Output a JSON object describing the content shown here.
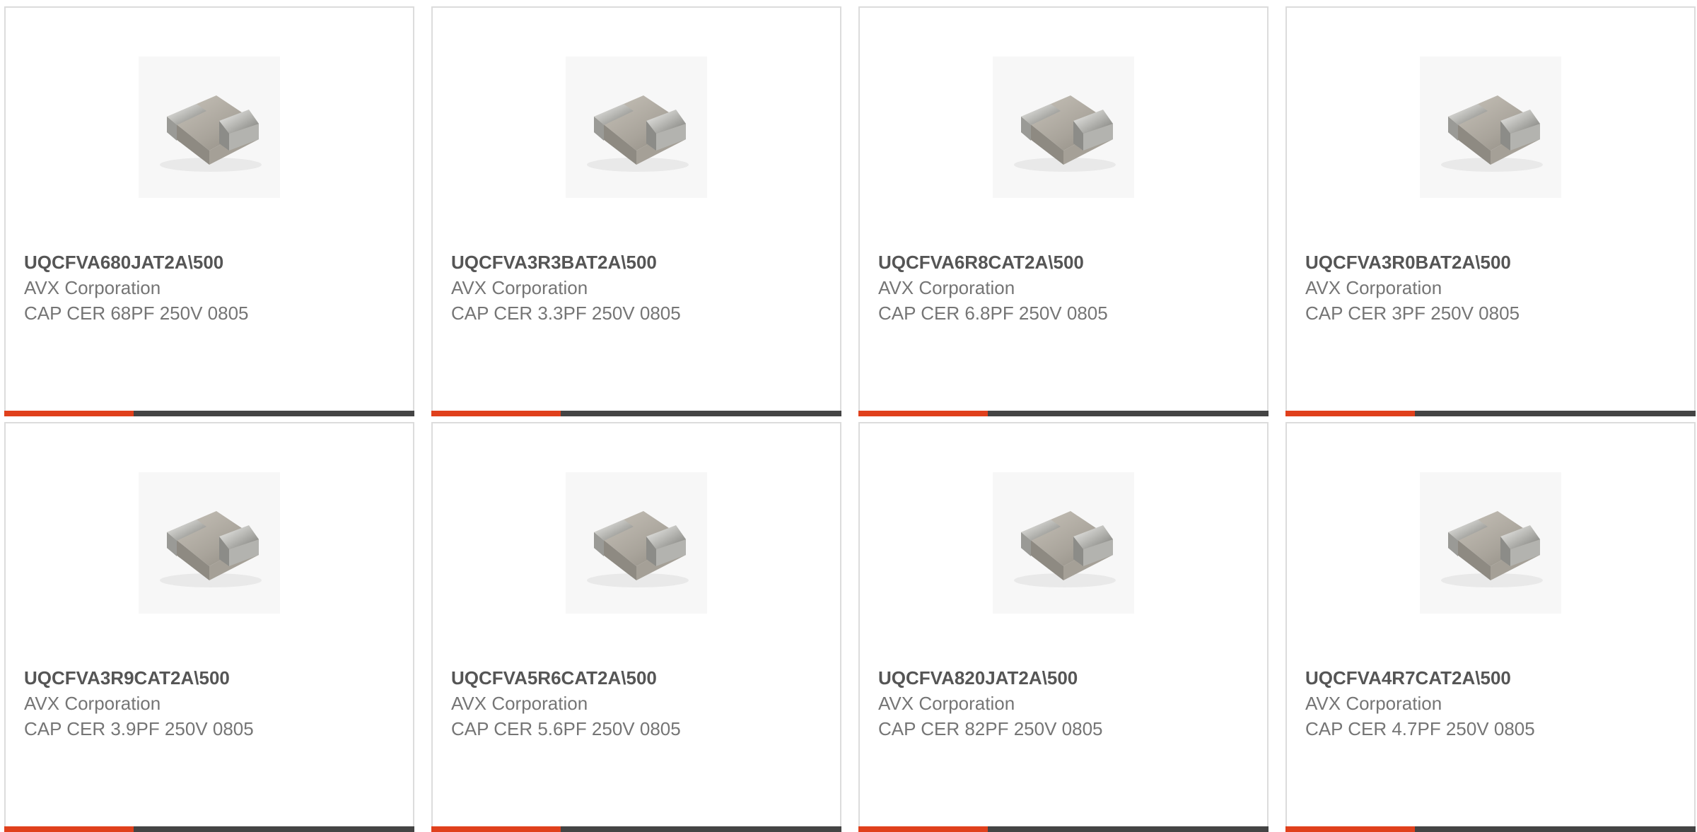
{
  "accent_color": "#e0401c",
  "bar_color": "#444444",
  "products": [
    {
      "part_number": "UQCFVA680JAT2A\\500",
      "manufacturer": "AVX Corporation",
      "description": "CAP CER 68PF 250V 0805",
      "image_icon": "ceramic-capacitor-icon"
    },
    {
      "part_number": "UQCFVA3R3BAT2A\\500",
      "manufacturer": "AVX Corporation",
      "description": "CAP CER 3.3PF 250V 0805",
      "image_icon": "ceramic-capacitor-icon"
    },
    {
      "part_number": "UQCFVA6R8CAT2A\\500",
      "manufacturer": "AVX Corporation",
      "description": "CAP CER 6.8PF 250V 0805",
      "image_icon": "ceramic-capacitor-icon"
    },
    {
      "part_number": "UQCFVA3R0BAT2A\\500",
      "manufacturer": "AVX Corporation",
      "description": "CAP CER 3PF 250V 0805",
      "image_icon": "ceramic-capacitor-icon"
    },
    {
      "part_number": "UQCFVA3R9CAT2A\\500",
      "manufacturer": "AVX Corporation",
      "description": "CAP CER 3.9PF 250V 0805",
      "image_icon": "ceramic-capacitor-icon"
    },
    {
      "part_number": "UQCFVA5R6CAT2A\\500",
      "manufacturer": "AVX Corporation",
      "description": "CAP CER 5.6PF 250V 0805",
      "image_icon": "ceramic-capacitor-icon"
    },
    {
      "part_number": "UQCFVA820JAT2A\\500",
      "manufacturer": "AVX Corporation",
      "description": "CAP CER 82PF 250V 0805",
      "image_icon": "ceramic-capacitor-icon"
    },
    {
      "part_number": "UQCFVA4R7CAT2A\\500",
      "manufacturer": "AVX Corporation",
      "description": "CAP CER 4.7PF 250V 0805",
      "image_icon": "ceramic-capacitor-icon"
    }
  ]
}
